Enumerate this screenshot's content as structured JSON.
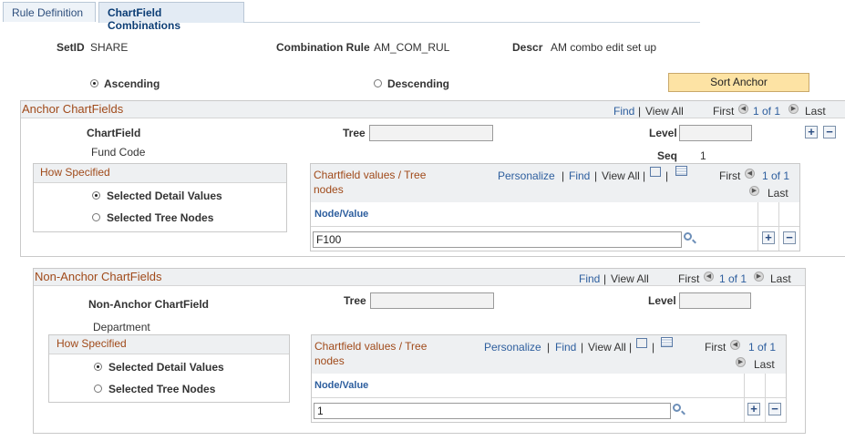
{
  "tabs": [
    {
      "label": "Rule Definition"
    },
    {
      "label": "ChartField Combinations"
    }
  ],
  "header": {
    "setid_label": "SetID",
    "setid_value": "SHARE",
    "rule_label": "Combination Rule",
    "rule_value": "AM_COM_RUL",
    "descr_label": "Descr",
    "descr_value": "AM combo edit set up"
  },
  "sort": {
    "ascending": "Ascending",
    "descending": "Descending",
    "selected": "Ascending",
    "anchor_button": "Sort Anchor"
  },
  "anchor": {
    "title": "Anchor ChartFields",
    "find": "Find",
    "view_all": "View All",
    "first": "First",
    "range": "1 of 1",
    "last": "Last",
    "chartfield_label": "ChartField",
    "chartfield_value": "Fund Code",
    "tree_label": "Tree",
    "tree_value": "",
    "level_label": "Level",
    "level_value": "",
    "seq_label": "Seq",
    "seq_value": "1",
    "how": {
      "title": "How Specified",
      "opt1": "Selected Detail Values",
      "opt2": "Selected Tree Nodes",
      "selected": "Selected Detail Values"
    },
    "grid": {
      "title_line1": "Chartfield values / Tree",
      "title_line2": "nodes",
      "personalize": "Personalize",
      "find": "Find",
      "view_all": "View All",
      "first": "First",
      "range": "1 of 1",
      "last": "Last",
      "col": "Node/Value",
      "value": "F100"
    }
  },
  "nonanchor": {
    "title": "Non-Anchor ChartFields",
    "find": "Find",
    "view_all": "View All",
    "first": "First",
    "range": "1 of 1",
    "last": "Last",
    "chartfield_label": "Non-Anchor ChartField",
    "chartfield_value": "Department",
    "tree_label": "Tree",
    "tree_value": "",
    "level_label": "Level",
    "level_value": "",
    "how": {
      "title": "How Specified",
      "opt1": "Selected Detail Values",
      "opt2": "Selected Tree Nodes",
      "selected": "Selected Detail Values"
    },
    "grid": {
      "title_line1": "Chartfield values / Tree",
      "title_line2": "nodes",
      "personalize": "Personalize",
      "find": "Find",
      "view_all": "View All",
      "first": "First",
      "range": "1 of 1",
      "last": "Last",
      "col": "Node/Value",
      "value": "1"
    }
  },
  "icons": {
    "add": "+",
    "remove": "−",
    "lookup": "magnifier-icon",
    "prev": "◀",
    "next": "▶"
  }
}
